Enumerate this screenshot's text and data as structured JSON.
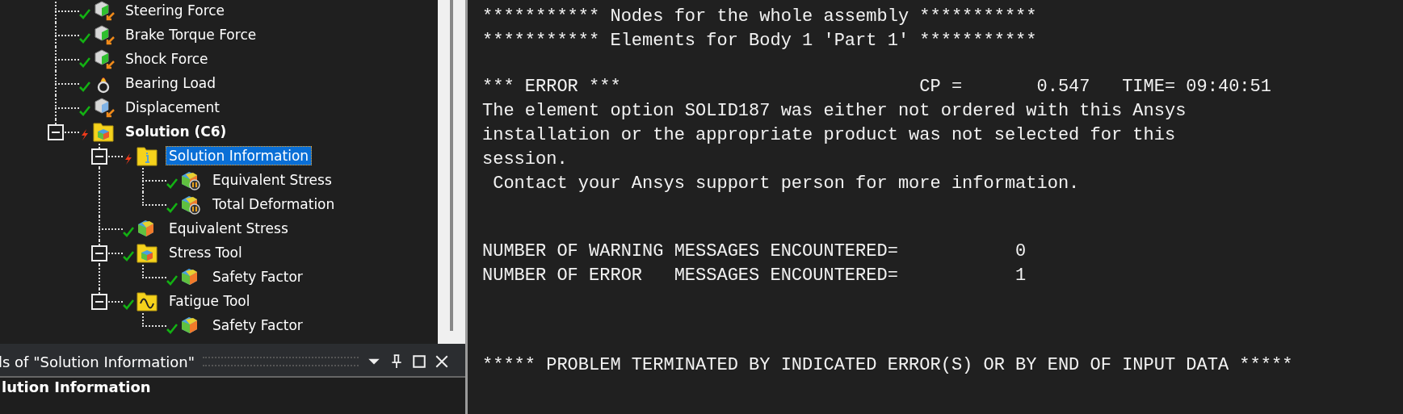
{
  "tree": [
    {
      "label": "Steering Force",
      "solved": true,
      "kind": "force",
      "bold": false,
      "selected": false
    },
    {
      "label": "Brake Torque Force",
      "solved": true,
      "kind": "force",
      "bold": false,
      "selected": false
    },
    {
      "label": "Shock Force",
      "solved": true,
      "kind": "force",
      "bold": false,
      "selected": false
    },
    {
      "label": "Bearing Load",
      "solved": true,
      "kind": "bearing",
      "bold": false,
      "selected": false
    },
    {
      "label": "Displacement",
      "solved": true,
      "kind": "displacement",
      "bold": false,
      "selected": false
    },
    {
      "label": "Solution (C6)",
      "solved": false,
      "kind": "solution",
      "bold": true,
      "selected": false,
      "expanded": true,
      "children": [
        {
          "label": "Solution Information",
          "solved": false,
          "kind": "info",
          "bold": false,
          "selected": true,
          "expanded": true,
          "children": [
            {
              "label": "Equivalent Stress",
              "solved": true,
              "kind": "probe",
              "bold": false,
              "selected": false
            },
            {
              "label": "Total Deformation",
              "solved": true,
              "kind": "probe",
              "bold": false,
              "selected": false
            }
          ]
        },
        {
          "label": "Equivalent Stress",
          "solved": true,
          "kind": "result",
          "bold": false,
          "selected": false
        },
        {
          "label": "Stress Tool",
          "solved": true,
          "kind": "tool",
          "bold": false,
          "selected": false,
          "expanded": true,
          "children": [
            {
              "label": "Safety Factor",
              "solved": true,
              "kind": "result",
              "bold": false,
              "selected": false
            }
          ]
        },
        {
          "label": "Fatigue Tool",
          "solved": true,
          "kind": "fatigue",
          "bold": false,
          "selected": false,
          "expanded": true,
          "children": [
            {
              "label": "Safety Factor",
              "solved": true,
              "kind": "result",
              "bold": false,
              "selected": false
            }
          ]
        }
      ]
    }
  ],
  "details_panel": {
    "title": "ls of \"Solution Information\"",
    "content_heading": "lution Information"
  },
  "output": [
    [
      "*********** Nodes for the whole assembly ***********",
      "*********** Elements for Body 1 'Part 1' ***********"
    ],
    [
      "*** ERROR ***                            CP =       0.547   TIME= 09:40:51",
      "The element option SOLID187 was either not ordered with this Ansys",
      "installation or the appropriate product was not selected for this",
      "session.",
      " Contact your Ansys support person for more information."
    ],
    [
      "NUMBER OF WARNING MESSAGES ENCOUNTERED=           0",
      "NUMBER OF ERROR   MESSAGES ENCOUNTERED=           1"
    ],
    [
      "***** PROBLEM TERMINATED BY INDICATED ERROR(S) OR BY END OF INPUT DATA *****"
    ]
  ]
}
